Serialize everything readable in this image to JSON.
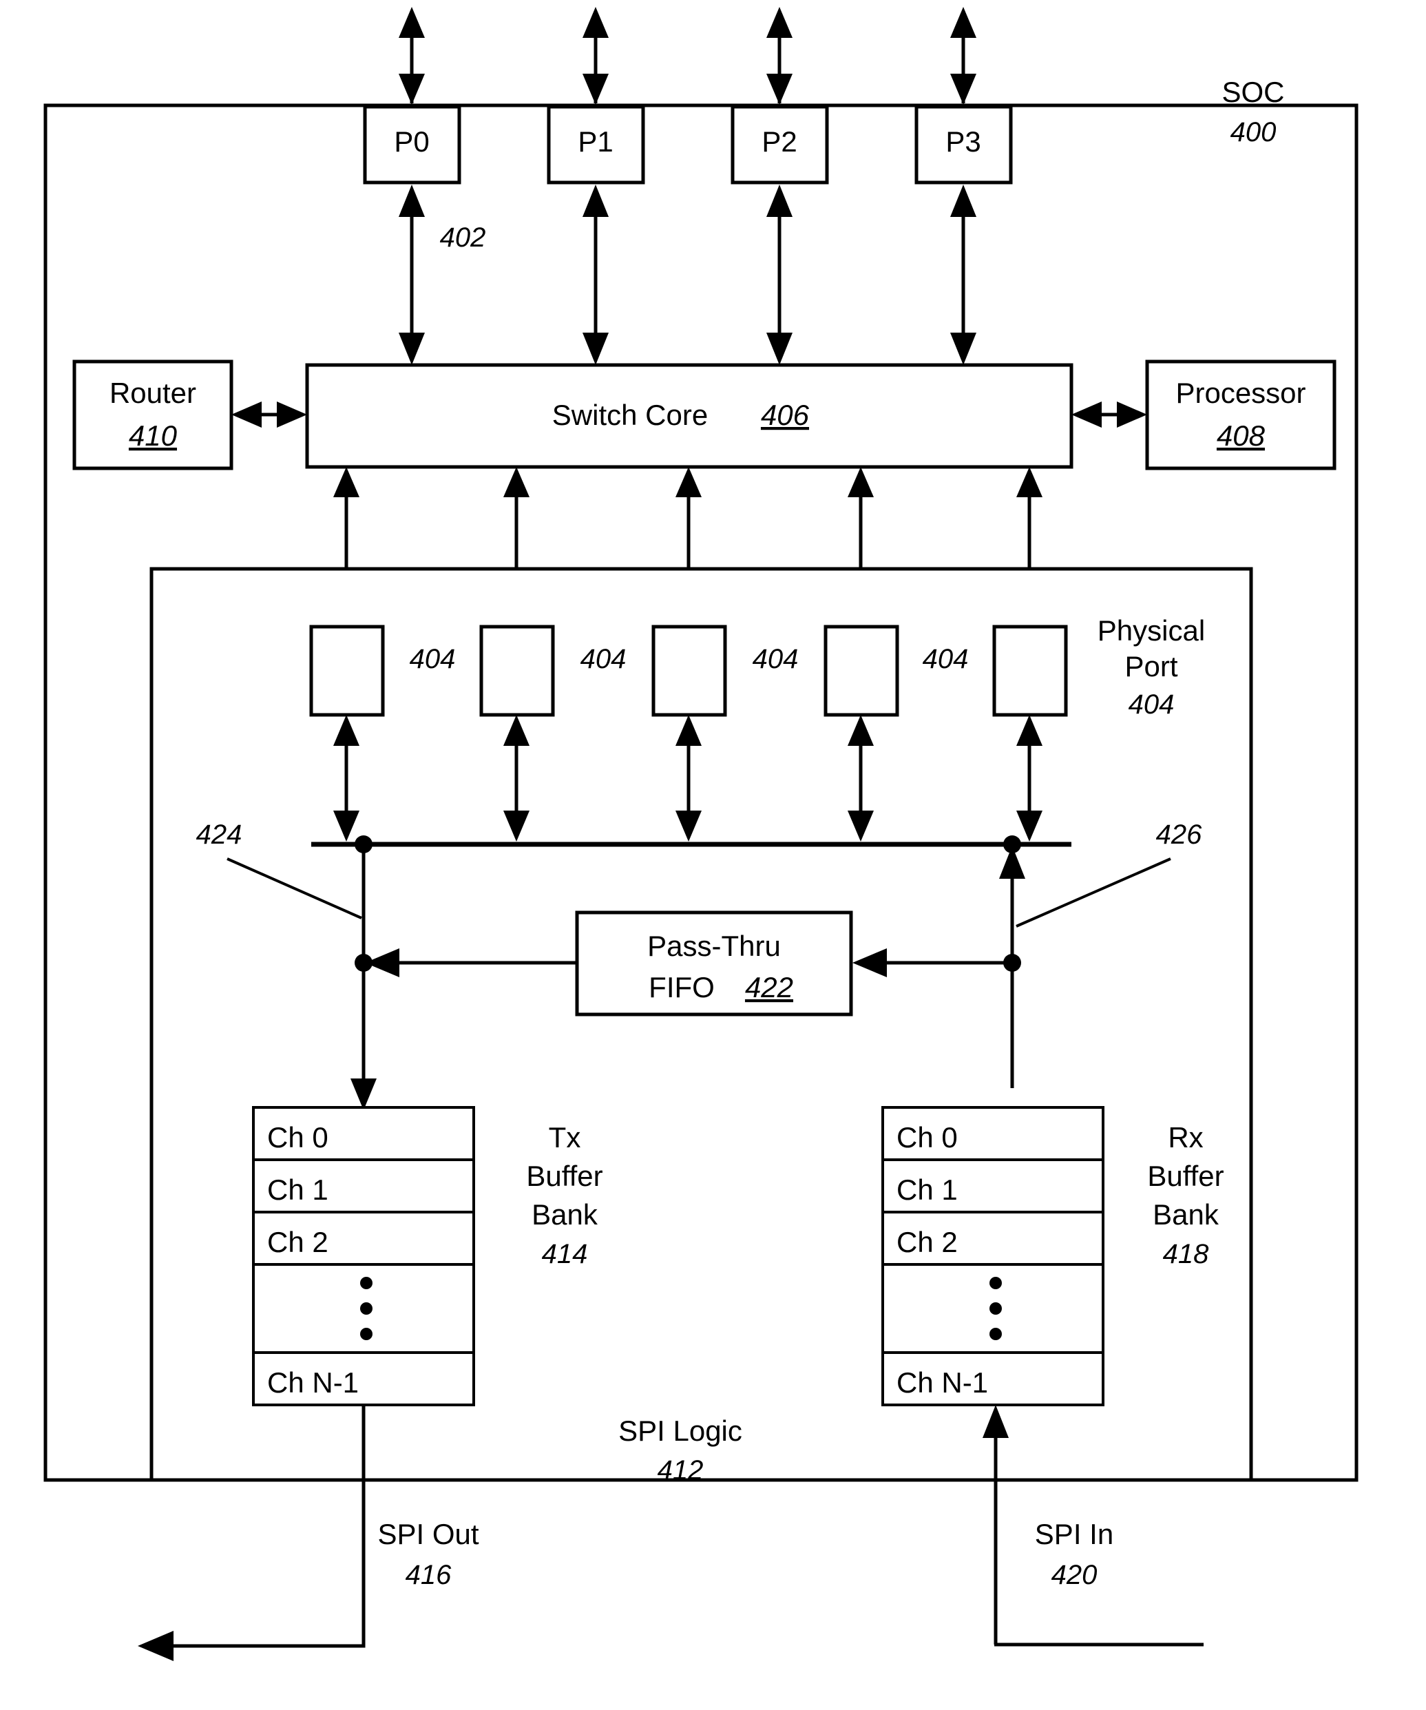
{
  "figure": {
    "title": "SOC switch with SPI logic block diagram",
    "soc": {
      "label": "SOC",
      "ref": "400"
    },
    "external_ports": [
      {
        "label": "P0"
      },
      {
        "label": "P1"
      },
      {
        "label": "P2"
      },
      {
        "label": "P3"
      }
    ],
    "external_port_link_ref": "402",
    "switch_core": {
      "label": "Switch Core",
      "ref": "406"
    },
    "router": {
      "label": "Router",
      "ref": "410"
    },
    "processor": {
      "label": "Processor",
      "ref": "408"
    },
    "physical_ports": {
      "legend_line1": "Physical",
      "legend_line2": "Port",
      "legend_ref": "404",
      "inline_refs": [
        "404",
        "404",
        "404",
        "404"
      ],
      "count": 5
    },
    "tx_path_ref": "424",
    "rx_path_ref": "426",
    "pass_thru_fifo": {
      "line1": "Pass-Thru",
      "line2": "FIFO",
      "ref": "422"
    },
    "tx_buffer_bank": {
      "line1": "Tx",
      "line2": "Buffer",
      "line3": "Bank",
      "ref": "414",
      "channels": [
        "Ch 0",
        "Ch 1",
        "Ch 2",
        "",
        "Ch N-1"
      ],
      "ellipsis": "vertical-dots"
    },
    "rx_buffer_bank": {
      "line1": "Rx",
      "line2": "Buffer",
      "line3": "Bank",
      "ref": "418",
      "channels": [
        "Ch 0",
        "Ch 1",
        "Ch 2",
        "",
        "Ch N-1"
      ],
      "ellipsis": "vertical-dots"
    },
    "spi_logic": {
      "label": "SPI Logic",
      "ref": "412"
    },
    "spi_out": {
      "label": "SPI Out",
      "ref": "416"
    },
    "spi_in": {
      "label": "SPI In",
      "ref": "420"
    }
  },
  "colors": {
    "ink": "#000000",
    "paper": "#ffffff"
  }
}
